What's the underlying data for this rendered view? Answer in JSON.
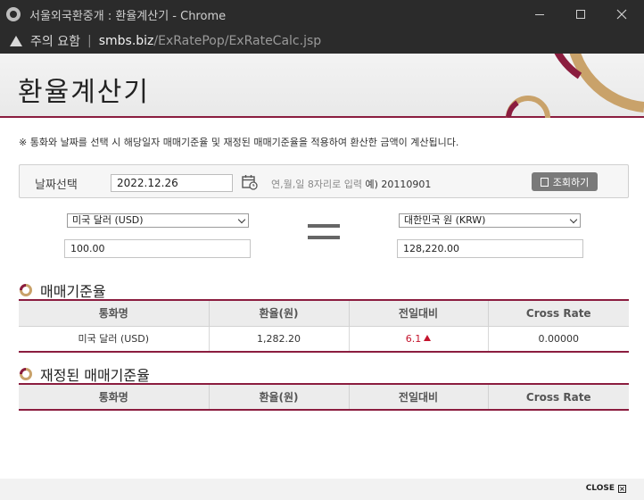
{
  "window": {
    "title": "서울외국환중개 : 환율계산기 - Chrome",
    "favicon": "globe-icon"
  },
  "addressbar": {
    "security_label": "주의 요함",
    "host": "smbs.biz",
    "path": "/ExRatePop/ExRateCalc.jsp"
  },
  "page": {
    "title": "환율계산기",
    "notice": "※ 통화와 날짜를 선택 시 해당일자 매매기준율 및 재정된 매매기준율을 적용하여 환산한 금액이 계산됩니다.",
    "accent_color": "#8b1d3f"
  },
  "search": {
    "label": "날짜선택",
    "date_value": "2022.12.26",
    "hint": "연,월,일 8자리로 입력",
    "hint_example": "예) 20110901",
    "button_label": "조회하기"
  },
  "converter": {
    "from_currency": "미국 달러 (USD)",
    "from_amount": "100.00",
    "to_currency": "대한민국 원 (KRW)",
    "to_amount": "128,220.00"
  },
  "section1": {
    "title": "매매기준율",
    "headers": [
      "통화명",
      "환율(원)",
      "전일대비",
      "Cross Rate"
    ],
    "row": {
      "currency": "미국 달러 (USD)",
      "rate": "1,282.20",
      "change": "6.1",
      "cross_rate": "0.00000"
    }
  },
  "section2": {
    "title": "재정된 매매기준율",
    "headers": [
      "통화명",
      "환율(원)",
      "전일대비",
      "Cross Rate"
    ]
  },
  "footer": {
    "close_label": "CLOSE"
  }
}
